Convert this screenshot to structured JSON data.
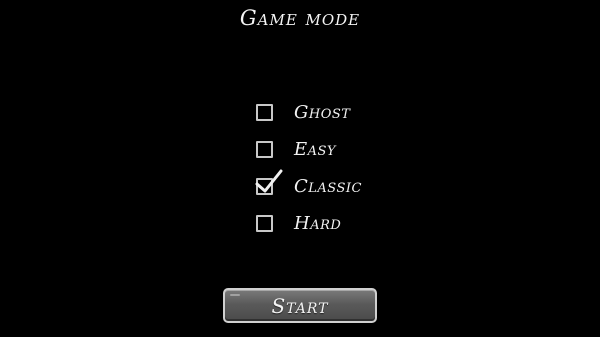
{
  "title": "Game mode",
  "options": [
    {
      "label": "Ghost",
      "checked": false
    },
    {
      "label": "Easy",
      "checked": false
    },
    {
      "label": "Classic",
      "checked": true
    },
    {
      "label": "Hard",
      "checked": false
    }
  ],
  "start_button": {
    "label": "Start"
  },
  "colors": {
    "background": "#000000",
    "text": "#f2f2f2",
    "checkbox_border": "#c8c8c8",
    "button_fill": "#5a5a5a"
  },
  "icons": {
    "check": "checkmark-icon"
  }
}
